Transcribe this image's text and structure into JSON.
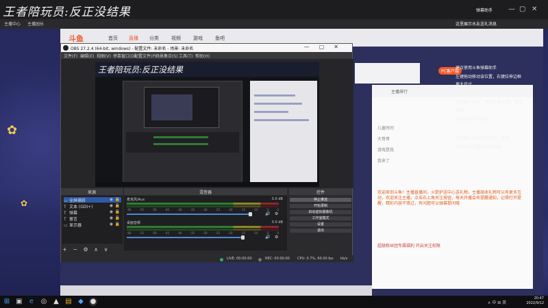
{
  "stream_title": "王者陪玩员:反正没结果",
  "browser": {
    "tab_items": [
      "主播中心",
      "主播园长"
    ],
    "window_controls": [
      "—",
      "▢",
      "✕"
    ],
    "top_right_label": "弹幕助手"
  },
  "douyu": {
    "logo": "斗鱼",
    "nav": [
      "首页",
      "直播",
      "分类",
      "视频",
      "游戏",
      "鱼吧"
    ],
    "pc_badge": "PC客户端",
    "room_rank": "主播排行",
    "chat_users": [
      "儿童时间",
      "大哥哥",
      "游戏是我",
      "我来了"
    ],
    "chat_message": "欢迎来到斗鱼！主播直播间，火箭护送中心送礼物，主播接收礼物可以有更多互动，欢迎关注主播，点击右上角关注按钮，每天开播会有提醒通知，记得打开提醒，精彩内容不错过，有问题可以弹幕提问哦",
    "chat_footer": "超级粉丝团专属福利 开启关注权限"
  },
  "notifications": [
    "这里展示水友送礼消息",
    "建议使用斗鱼弹幕助手",
    "左键拖动移动该位置，右键拉伸边框",
    "更大尺寸",
    "右上角有设置菜单",
    "这里展示弹幕，表扬开通/续费，粉丝",
    "徽章",
    "添加弹幕助手成功",
    "这里展示你收到的礼物，道具",
    "感谢有可设置小礼物屏蔽"
  ],
  "obs": {
    "title": "OBS 27.2.4 (64-bit, windows) - 配置文件: 未命名 - 场景: 未命名",
    "menu": [
      "文件(F)",
      "编辑(E)",
      "视图(V)",
      "停靠窗口(D)",
      "配置文件(P)",
      "场景集合(S)",
      "工具(T)",
      "帮助(H)"
    ],
    "preview_banner": "王者陪玩员:反正没结果",
    "docks": {
      "sources": "来源",
      "mixer": "混音器",
      "controls": "控件"
    },
    "sources": [
      {
        "icon": "▭",
        "name": "全屏捕获"
      },
      {
        "icon": "T",
        "name": "文本 (GDI+)"
      },
      {
        "icon": "T",
        "name": "弹幕"
      },
      {
        "icon": "T",
        "name": "留言"
      },
      {
        "icon": "▭",
        "name": "显示器"
      }
    ],
    "source_tools": [
      "+",
      "−",
      "⚙",
      "∧",
      "∨"
    ],
    "mixer": [
      {
        "name": "麦克风/Aux",
        "db": "0.0 dB",
        "volume": 0.92
      },
      {
        "name": "桌面音频",
        "db": "0.0 dB",
        "volume": 0.86
      }
    ],
    "meter_scale": [
      "-60",
      "-55",
      "-50",
      "-45",
      "-40",
      "-35",
      "-30",
      "-25",
      "-20",
      "-15",
      "-10",
      "-5",
      "0"
    ],
    "controls": [
      {
        "label": "停止推流",
        "active": true
      },
      {
        "label": "开始录制",
        "active": false
      },
      {
        "label": "启动虚拟摄像机",
        "active": false
      },
      {
        "label": "工作室模式",
        "active": false
      },
      {
        "label": "设置",
        "active": false
      },
      {
        "label": "退出",
        "active": false
      }
    ],
    "status": {
      "live": "LIVE: 00:00:00",
      "rec": "REC: 00:00:00",
      "cpu": "CPU: 0.7%, 60.00 fps",
      "kbps": "kb/s"
    }
  },
  "taskbar": {
    "time": "20:47",
    "date": "2022/9/12",
    "tray": "∧ 中 ⊞ 英"
  }
}
